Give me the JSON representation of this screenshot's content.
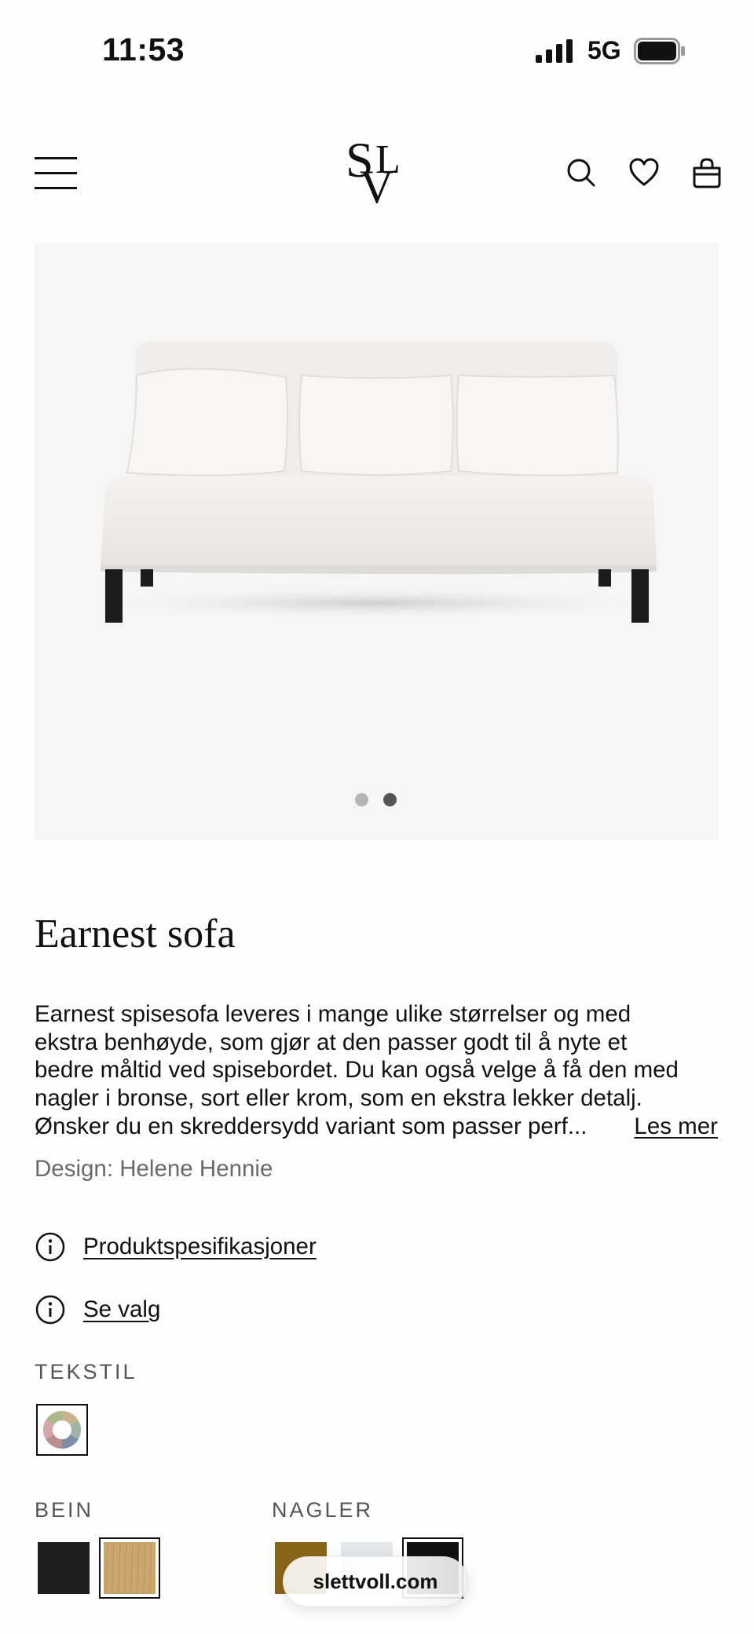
{
  "status_bar": {
    "time": "11:53",
    "network": "5G"
  },
  "header": {
    "logo_text": "SLV",
    "icons": [
      "menu-icon",
      "search-icon",
      "heart-icon",
      "bag-icon"
    ]
  },
  "gallery": {
    "slide_count": 2,
    "active_slide": 2
  },
  "product": {
    "title": "Earnest sofa",
    "description_lines": [
      "Earnest spisesofa leveres i mange ulike størrelser og med",
      "ekstra benhøyde, som gjør at den passer godt til å nyte et",
      "bedre måltid ved spisebordet. Du kan også velge å få den med",
      "nagler i bronse, sort eller krom, som en ekstra lekker detalj.",
      "Ønsker du en skreddersydd variant som passer perf..."
    ],
    "read_more": "Les mer",
    "designer": "Design: Helene Hennie"
  },
  "links": {
    "specs": "Produktspesifikasjoner",
    "options": "Se valg"
  },
  "options": {
    "textile_label": "TEKSTIL",
    "legs_label": "BEIN",
    "legs": [
      {
        "name": "black",
        "color": "#1e1e1e",
        "selected": false
      },
      {
        "name": "oak",
        "color": "#c8a56c",
        "selected": true
      }
    ],
    "nails_label": "NAGLER",
    "nails": [
      {
        "name": "bronze",
        "color": "#8a6418",
        "selected": false
      },
      {
        "name": "chrome",
        "color": "#e6e7ea",
        "selected": false
      },
      {
        "name": "black",
        "color": "#111111",
        "selected": true
      }
    ]
  },
  "browser": {
    "url": "slettvoll.com"
  },
  "colors": {
    "text": "#111111",
    "muted": "#6a6a6a",
    "image_bg": "#f6f6f6",
    "dot_inactive": "#b5b5b5",
    "dot_active": "#555555"
  }
}
